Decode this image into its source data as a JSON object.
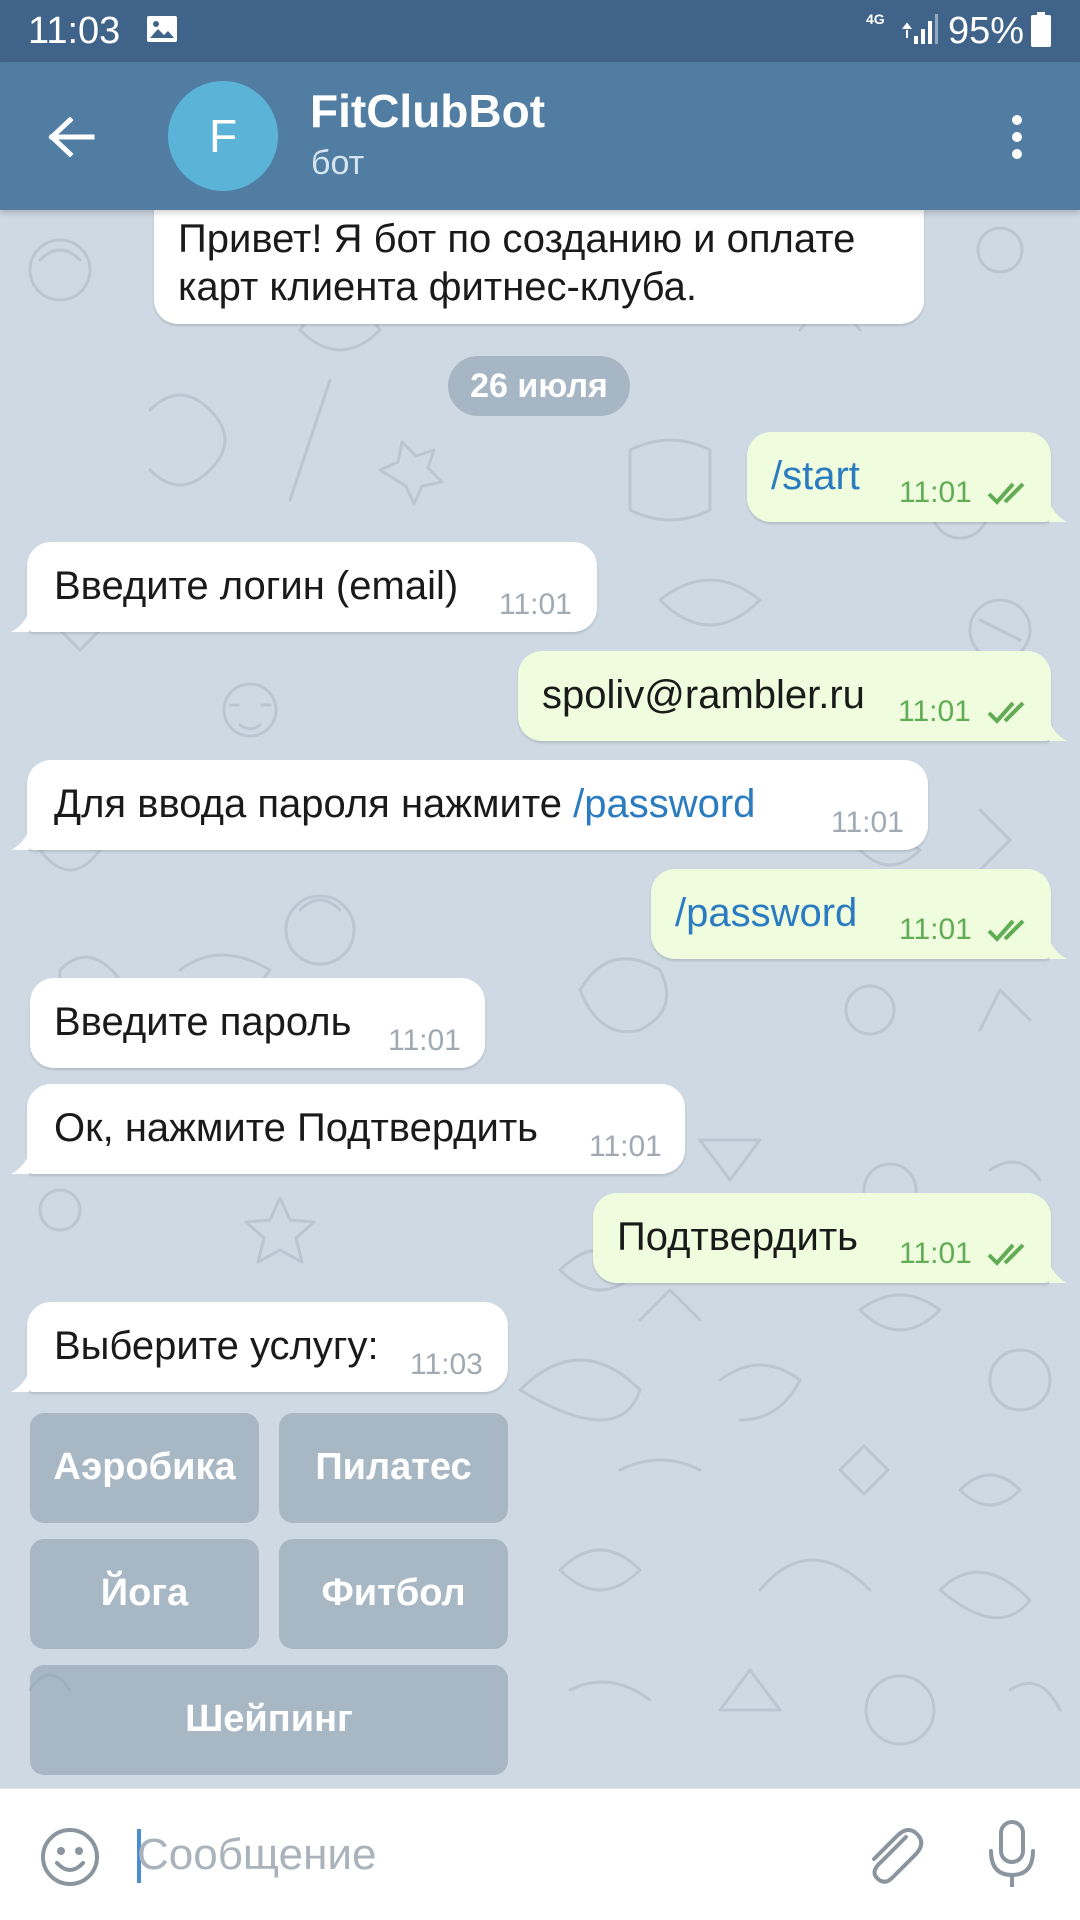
{
  "status_bar": {
    "time": "11:03",
    "network": "4G",
    "battery": "95%"
  },
  "header": {
    "avatar_letter": "F",
    "title": "FitClubBot",
    "subtitle": "бот"
  },
  "chat": {
    "date_chip": "26 июля",
    "intro": {
      "line1": "Привет! Я бот по созданию и оплате",
      "line2": "карт клиента фитнес-клуба."
    },
    "messages": [
      {
        "direction": "out",
        "text": "/start",
        "time": "11:01",
        "is_command": true,
        "read": true
      },
      {
        "direction": "in",
        "text": "Введите логин (email)",
        "time": "11:01"
      },
      {
        "direction": "out",
        "text": "spoliv@rambler.ru",
        "time": "11:01",
        "read": true
      },
      {
        "direction": "in",
        "text": "Для ввода пароля нажмите ",
        "link": "/password",
        "time": "11:01"
      },
      {
        "direction": "out",
        "text": "/password",
        "time": "11:01",
        "is_command": true,
        "read": true
      },
      {
        "direction": "in",
        "text": "Введите пароль",
        "time": "11:01"
      },
      {
        "direction": "in",
        "text": "Ок, нажмите Подтвердить",
        "time": "11:01"
      },
      {
        "direction": "out",
        "text": "Подтвердить",
        "time": "11:01",
        "read": true
      },
      {
        "direction": "in",
        "text": "Выберите услугу:",
        "time": "11:03"
      }
    ],
    "keyboard": [
      "Аэробика",
      "Пилатес",
      "Йога",
      "Фитбол",
      "Шейпинг"
    ]
  },
  "input": {
    "placeholder": "Сообщение"
  },
  "colors": {
    "status_bar": "#40638a",
    "header": "#517da2",
    "background": "#cfd9e3",
    "incoming_bubble": "#ffffff",
    "outgoing_bubble": "#effdde",
    "link": "#2b7bc0",
    "outgoing_time": "#62ac55",
    "avatar": "#5bb3d8"
  },
  "icons": [
    "arrow-back-icon",
    "more-vert-icon",
    "image-icon",
    "signal-icon",
    "battery-icon",
    "double-check-icon",
    "emoji-icon",
    "paperclip-icon",
    "microphone-icon"
  ]
}
